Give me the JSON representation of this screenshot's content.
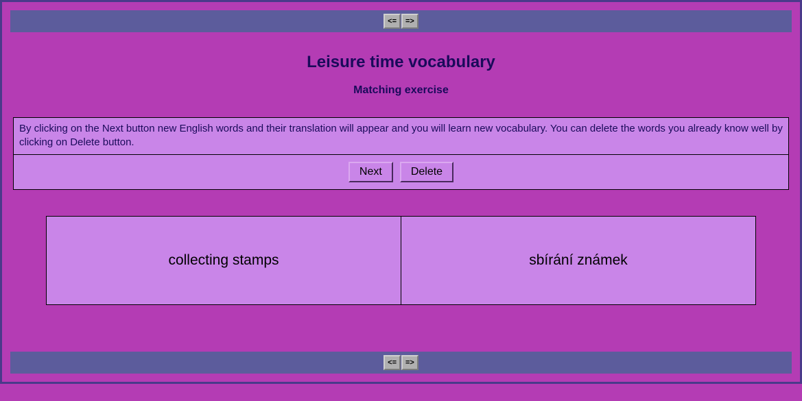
{
  "nav": {
    "prev_label": "<=",
    "next_label": "=>"
  },
  "header": {
    "title": "Leisure time vocabulary",
    "subtitle": "Matching exercise"
  },
  "instructions": "By clicking on the Next button new English words and their translation will appear and you will learn new vocabulary. You can delete the words you already know well by clicking on Delete button.",
  "controls": {
    "next_label": "Next",
    "delete_label": "Delete"
  },
  "cards": {
    "english": "collecting stamps",
    "translation": "sbírání známek"
  }
}
